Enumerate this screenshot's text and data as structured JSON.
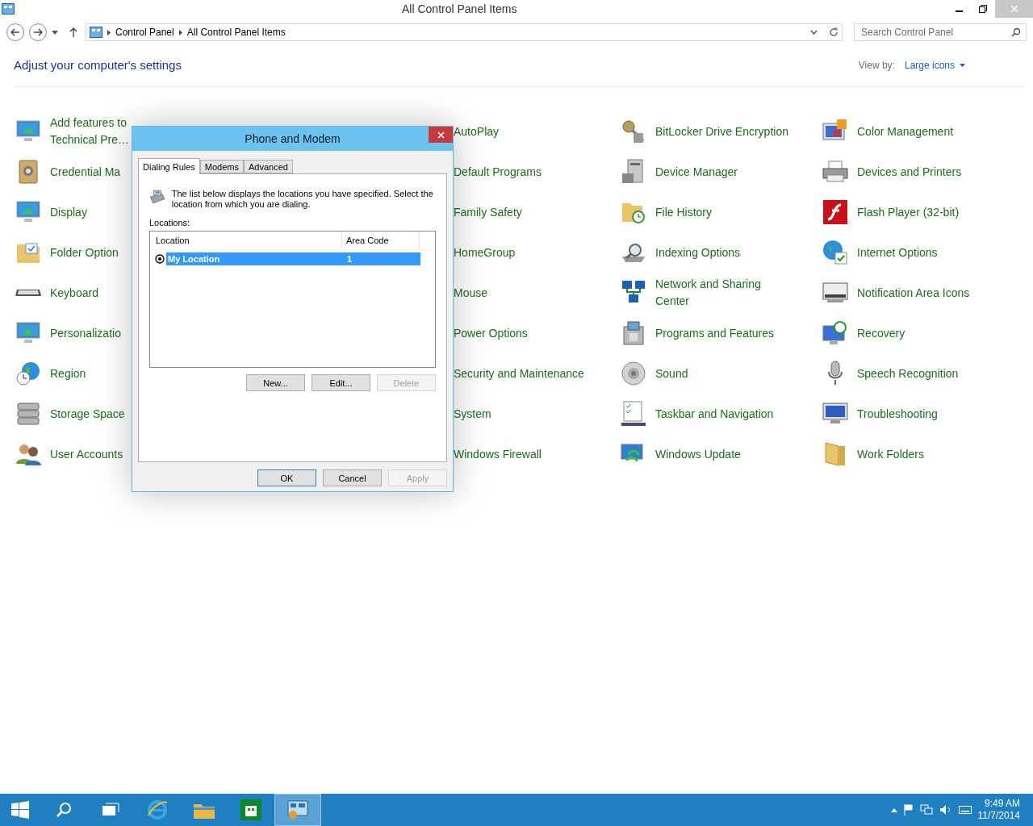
{
  "window": {
    "title": "All Control Panel Items"
  },
  "address": {
    "crumbs": [
      "Control Panel",
      "All Control Panel Items"
    ],
    "search_placeholder": "Search Control Panel"
  },
  "header": {
    "title": "Adjust your computer's settings",
    "view_by_label": "View by:",
    "view_by_value": "Large icons"
  },
  "columns": [
    {
      "icons": true,
      "items": [
        "Add features to\nTechnical Pre…",
        "Credential Ma",
        "Display",
        "Folder Option",
        "Keyboard",
        "Personalizatio",
        "Region",
        "Storage Space",
        "User Accounts"
      ]
    },
    {
      "icons": false,
      "items": [
        "AutoPlay",
        "Default Programs",
        "Family Safety",
        "HomeGroup",
        "Mouse",
        "Power Options",
        "Security and Maintenance",
        "System",
        "Windows Firewall"
      ]
    },
    {
      "icons": true,
      "items": [
        "BitLocker Drive Encryption",
        "Device Manager",
        "File History",
        "Indexing Options",
        "Network and Sharing\nCenter",
        "Programs and Features",
        "Sound",
        "Taskbar and Navigation",
        "Windows Update"
      ]
    },
    {
      "icons": true,
      "items": [
        "Color Management",
        "Devices and Printers",
        "Flash Player (32-bit)",
        "Internet Options",
        "Notification Area Icons",
        "Recovery",
        "Speech Recognition",
        "Troubleshooting",
        "Work Folders"
      ]
    }
  ],
  "dialog": {
    "title": "Phone and Modem",
    "tabs": [
      {
        "label": "Dialing Rules",
        "selected": true
      },
      {
        "label": "Modems",
        "selected": false
      },
      {
        "label": "Advanced",
        "selected": false
      }
    ],
    "description": "The list below displays the locations you have specified. Select the location from which you are dialing.",
    "list_label": "Locations:",
    "list_columns": [
      "Location",
      "Area Code"
    ],
    "rows": [
      {
        "location": "My Location",
        "area_code": "1",
        "selected": true
      }
    ],
    "list_buttons": [
      {
        "label": "New...",
        "disabled": false
      },
      {
        "label": "Edit...",
        "disabled": false
      },
      {
        "label": "Delete",
        "disabled": true
      }
    ],
    "buttons": [
      {
        "label": "OK",
        "disabled": false,
        "default": true
      },
      {
        "label": "Cancel",
        "disabled": false,
        "default": false
      },
      {
        "label": "Apply",
        "disabled": true,
        "default": false
      }
    ]
  },
  "taskbar": {
    "apps": [
      {
        "selected": false
      },
      {
        "selected": false
      },
      {
        "selected": false
      },
      {
        "selected": false
      },
      {
        "selected": false
      },
      {
        "selected": true
      }
    ],
    "time": "9:49 AM",
    "date": "11/7/2014"
  }
}
